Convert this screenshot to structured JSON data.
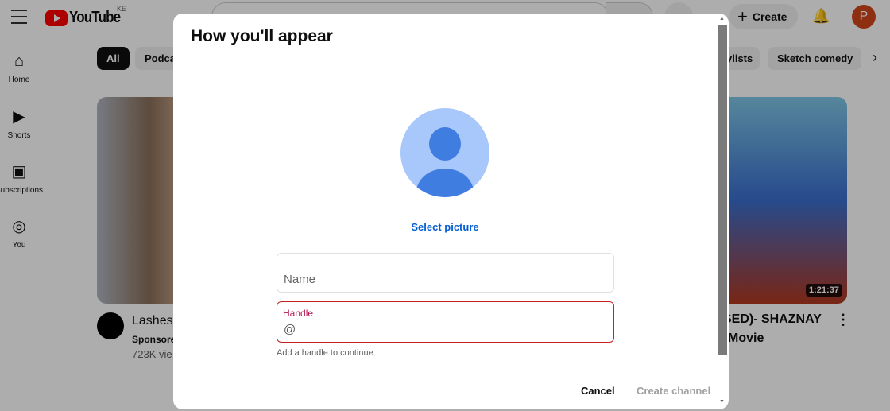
{
  "header": {
    "logo_text": "YouTube",
    "country_code": "KE",
    "create_label": "Create",
    "avatar_letter": "P",
    "avatar_color": "#d1461b"
  },
  "sidebar": {
    "items": [
      {
        "label": "Home",
        "icon": "home-icon"
      },
      {
        "label": "Shorts",
        "icon": "shorts-icon"
      },
      {
        "label": "Subscriptions",
        "icon": "subscriptions-icon"
      },
      {
        "label": "You",
        "icon": "you-icon"
      }
    ]
  },
  "chips": [
    "All",
    "Podca",
    "ylists",
    "Sketch comedy"
  ],
  "videos": [
    {
      "title": "Lashes",
      "channel": "Sponsore",
      "views": "723K vie"
    },
    {
      "title": "SED)- SHAZNAY",
      "title2": "Movie",
      "duration": "1:21:37"
    }
  ],
  "dialog": {
    "title": "How you'll appear",
    "select_picture": "Select picture",
    "name_placeholder": "Name",
    "handle_label": "Handle",
    "handle_prefix": "@",
    "handle_helper": "Add a handle to continue",
    "cancel_label": "Cancel",
    "create_label": "Create channel",
    "error_color": "#c5221f",
    "link_color": "#065fd4"
  }
}
